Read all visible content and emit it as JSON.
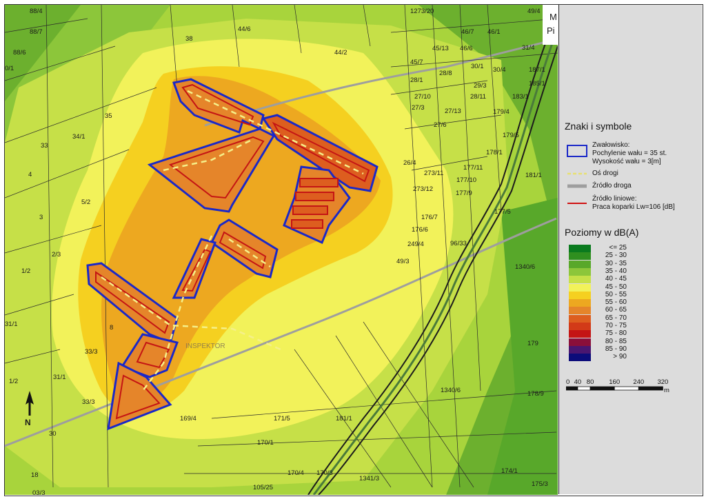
{
  "legend": {
    "symbols_title": "Znaki i symbole",
    "symbols": [
      {
        "icon": "blue-rectangle-icon",
        "lines": [
          "Zwałowisko:",
          "Pochylenie wału = 35 st.",
          "Wysokość wału = 3[m]"
        ]
      },
      {
        "icon": "dashed-yellow-line-icon",
        "lines": [
          "Oś drogi"
        ]
      },
      {
        "icon": "gray-line-icon",
        "lines": [
          "Źródło droga"
        ]
      },
      {
        "icon": "red-line-icon",
        "lines": [
          "Źródło liniowe:",
          "Praca koparki Lw=106 [dB]"
        ]
      }
    ],
    "levels_title": "Poziomy w dB(A)",
    "levels": [
      {
        "label": "<= 25",
        "color": "#0a7a1e"
      },
      {
        "label": "25  -  30",
        "color": "#2f8f1f"
      },
      {
        "label": "30  -  35",
        "color": "#58a82a"
      },
      {
        "label": "35  -  40",
        "color": "#8cc63a"
      },
      {
        "label": "40  -  45",
        "color": "#c6e048"
      },
      {
        "label": "45  -  50",
        "color": "#f2f25a"
      },
      {
        "label": "50  -  55",
        "color": "#f5d020"
      },
      {
        "label": "55  -  60",
        "color": "#eda820"
      },
      {
        "label": "60  -  65",
        "color": "#e5852a"
      },
      {
        "label": "65  -  70",
        "color": "#dd5e1f"
      },
      {
        "label": "70  -  75",
        "color": "#d23a18"
      },
      {
        "label": "75  -  80",
        "color": "#c41414"
      },
      {
        "label": "80  -  85",
        "color": "#8b0f3a"
      },
      {
        "label": "85  -  90",
        "color": "#4a1670"
      },
      {
        "label": "> 90",
        "color": "#0c0c7a"
      }
    ],
    "scale": {
      "ticks": [
        "0",
        "40",
        "80",
        "160",
        "240",
        "320"
      ],
      "unit": "m"
    }
  },
  "map": {
    "north_label": "N",
    "corner_text": [
      "M",
      "Pi"
    ],
    "watermark": "INSPEKTOR",
    "parcels": [
      "88/4",
      "88/7",
      "88/6",
      "0/1",
      "38",
      "44/6",
      "44/2",
      "1273/20",
      "49/4",
      "46/7",
      "46/1",
      "31/4",
      "45/13",
      "46/6",
      "45/7",
      "28/8",
      "30/1",
      "30/4",
      "187/1",
      "28/1",
      "29/3",
      "185/1",
      "183/1",
      "27/10",
      "28/11",
      "27/3",
      "27/13",
      "179/4",
      "27/6",
      "179/5",
      "35",
      "34/1",
      "33",
      "26/4",
      "178/1",
      "273/11",
      "177/11",
      "181/1",
      "4",
      "273/12",
      "177/10",
      "177/9",
      "5/2",
      "176/7",
      "177/5",
      "3",
      "176/6",
      "249/4",
      "96/33",
      "2/3",
      "49/3",
      "1340/6",
      "1/2",
      "31/1",
      "8",
      "179",
      "33/3",
      "1/2",
      "31/1",
      "1340/6",
      "178/9",
      "33/3",
      "169/4",
      "171/5",
      "181/1",
      "30",
      "170/1",
      "18",
      "170/4",
      "170/3",
      "1341/3",
      "174/1",
      "175/3",
      "03/3",
      "105/25"
    ]
  }
}
